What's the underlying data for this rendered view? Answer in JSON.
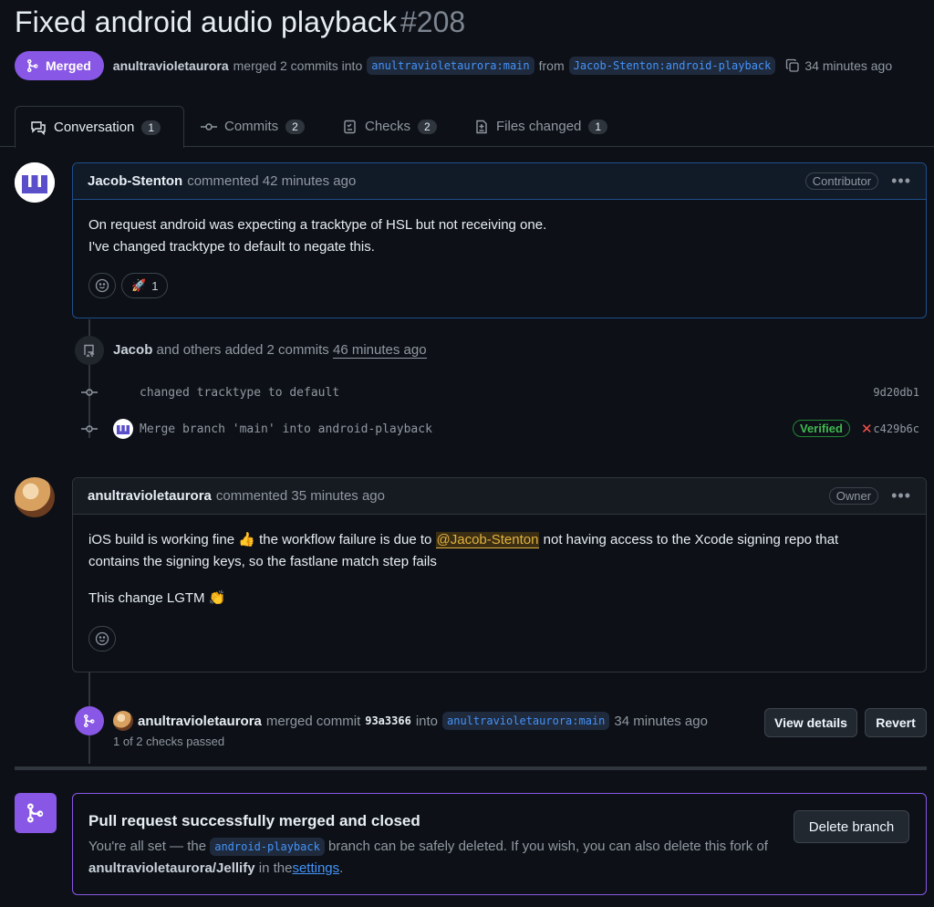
{
  "header": {
    "title": "Fixed android audio playback",
    "number": "#208",
    "state": "Merged",
    "author": "anultravioletaurora",
    "action": "merged 2 commits into",
    "base_branch": "anultravioletaurora:main",
    "from_word": "from",
    "head_branch": "Jacob-Stenton:android-playback",
    "time": "34 minutes ago"
  },
  "tabs": [
    {
      "label": "Conversation",
      "count": "1"
    },
    {
      "label": "Commits",
      "count": "2"
    },
    {
      "label": "Checks",
      "count": "2"
    },
    {
      "label": "Files changed",
      "count": "1"
    }
  ],
  "comment1": {
    "author": "Jacob-Stenton",
    "meta": "commented 42 minutes ago",
    "badge": "Contributor",
    "line1": "On request android was expecting a tracktype of HSL but not receiving one.",
    "line2": "I've changed tracktype to default to negate this.",
    "reaction_count": "1"
  },
  "commits_event": {
    "author": "Jacob",
    "text": "and others added 2 commits",
    "time": "46 minutes ago",
    "commits": [
      {
        "message": "changed tracktype to default",
        "sha": "9d20db1"
      },
      {
        "message": "Merge branch 'main' into android-playback",
        "verified": "Verified",
        "sha": "c429b6c"
      }
    ]
  },
  "comment2": {
    "author": "anultravioletaurora",
    "meta": "commented 35 minutes ago",
    "badge": "Owner",
    "p1_a": "iOS build is working fine 👍 the workflow failure is due to",
    "mention": "@Jacob-Stenton",
    "p1_b": "not having access to the Xcode signing repo that",
    "p1_c": "contains the signing keys, so the fastlane match step fails",
    "p2": "This change LGTM 👏"
  },
  "merge_event": {
    "author": "anultravioletaurora",
    "text": "merged commit",
    "sha": "93a3366",
    "into": "into",
    "branch": "anultravioletaurora:main",
    "time": "34 minutes ago",
    "checks": "1 of 2 checks passed",
    "view_details": "View details",
    "revert": "Revert"
  },
  "merged_box": {
    "title": "Pull request successfully merged and closed",
    "desc_a": "You're all set — the",
    "branch": "android-playback",
    "desc_b": "branch can be safely deleted. If you wish, you can also delete this fork",
    "desc_c": "of",
    "repo": "anultravioletaurora/Jellify",
    "desc_d": "in the",
    "link": "settings",
    "desc_e": ".",
    "delete_button": "Delete branch"
  },
  "colors": {
    "merged": "#8957e5",
    "link": "#4493f8",
    "bg": "#0d1117"
  }
}
